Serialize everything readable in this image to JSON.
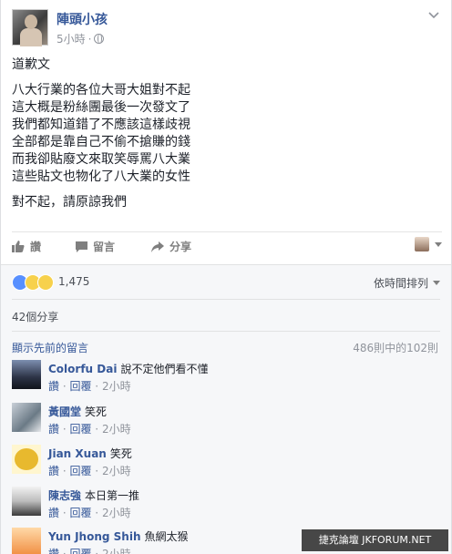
{
  "post": {
    "author": "陣頭小孩",
    "time": "5小時",
    "lines": [
      "道歉文",
      "八大行業的各位大哥大姐對不起",
      "這大概是粉絲團最後一次發文了",
      "我們都知道錯了不應該這樣歧視",
      "全部都是靠自己不偷不搶賺的錢",
      "而我卻貼廢文來取笑辱罵八大業",
      "這些貼文也物化了八大業的女性",
      "對不起，請原諒我們"
    ]
  },
  "actions": {
    "like": "讚",
    "comment": "留言",
    "share": "分享"
  },
  "reactions": {
    "count": "1,475",
    "sort_label": "依時間排列"
  },
  "shares": "42個分享",
  "comments_header": {
    "view_previous": "顯示先前的留言",
    "pager": "486則中的102則"
  },
  "comment_actions": {
    "like": "讚",
    "reply": "回覆",
    "time": "2小時"
  },
  "comments": [
    {
      "name": "Colorfu Dai",
      "text": "說不定他們看不懂"
    },
    {
      "name": "黃國堂",
      "text": "笑死"
    },
    {
      "name": "Jian Xuan",
      "text": "笑死"
    },
    {
      "name": "陳志強",
      "text": "本日第一推"
    },
    {
      "name": "Yun Jhong Shih",
      "text": "魚網太猴"
    }
  ],
  "watermark": "捷克論壇 JKFORUM.NET",
  "colors": {
    "link": "#365899",
    "muted": "#90949c",
    "like_blue": "#5890ff",
    "reaction_yellow": "#f7d14c"
  },
  "icons": [
    "globe-icon",
    "chevron-down-icon",
    "thumbs-up-icon",
    "comment-icon",
    "share-icon"
  ]
}
